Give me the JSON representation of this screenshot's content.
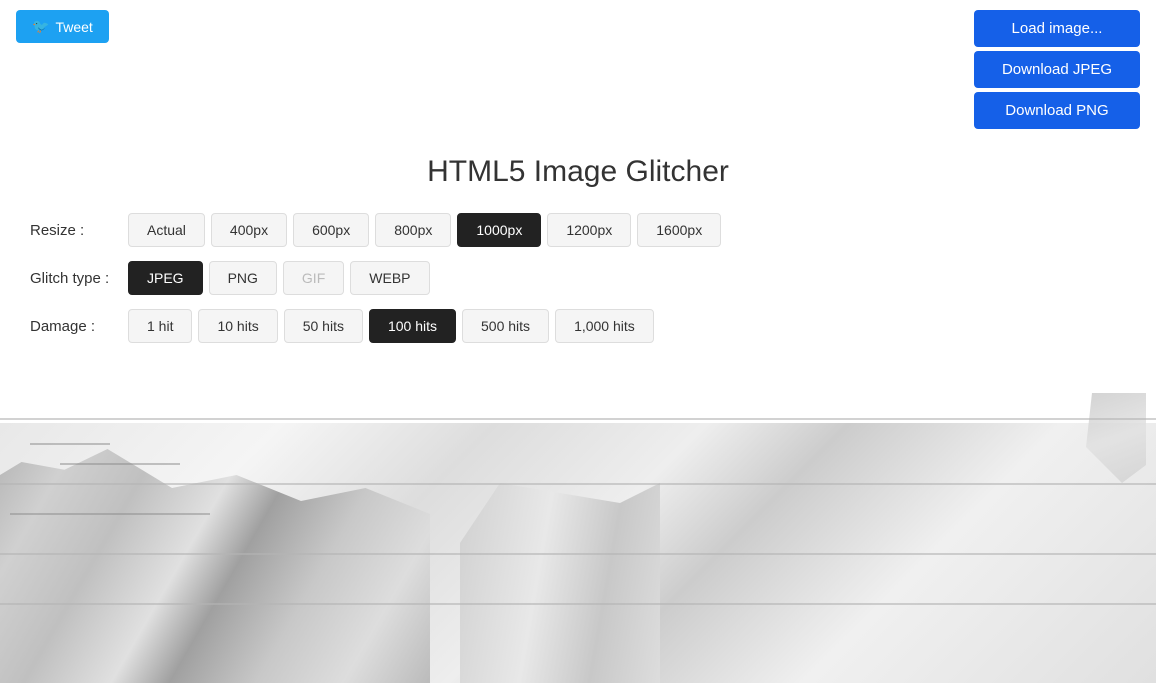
{
  "header": {
    "tweet_label": "Tweet",
    "title": "HTML5 Image Glitcher"
  },
  "buttons": {
    "load_image": "Load image...",
    "download_jpeg": "Download JPEG",
    "download_png": "Download PNG"
  },
  "resize": {
    "label": "Resize :",
    "options": [
      {
        "value": "actual",
        "label": "Actual",
        "active": false
      },
      {
        "value": "400px",
        "label": "400px",
        "active": false
      },
      {
        "value": "600px",
        "label": "600px",
        "active": false
      },
      {
        "value": "800px",
        "label": "800px",
        "active": false
      },
      {
        "value": "1000px",
        "label": "1000px",
        "active": true
      },
      {
        "value": "1200px",
        "label": "1200px",
        "active": false
      },
      {
        "value": "1600px",
        "label": "1600px",
        "active": false
      }
    ]
  },
  "glitch_type": {
    "label": "Glitch type :",
    "options": [
      {
        "value": "jpeg",
        "label": "JPEG",
        "active": true,
        "disabled": false
      },
      {
        "value": "png",
        "label": "PNG",
        "active": false,
        "disabled": false
      },
      {
        "value": "gif",
        "label": "GIF",
        "active": false,
        "disabled": true
      },
      {
        "value": "webp",
        "label": "WEBP",
        "active": false,
        "disabled": false
      }
    ]
  },
  "damage": {
    "label": "Damage :",
    "options": [
      {
        "value": "1",
        "label": "1 hit",
        "active": false
      },
      {
        "value": "10",
        "label": "10 hits",
        "active": false
      },
      {
        "value": "50",
        "label": "50 hits",
        "active": false
      },
      {
        "value": "100",
        "label": "100 hits",
        "active": true
      },
      {
        "value": "500",
        "label": "500 hits",
        "active": false
      },
      {
        "value": "1000",
        "label": "1,000 hits",
        "active": false
      }
    ]
  }
}
